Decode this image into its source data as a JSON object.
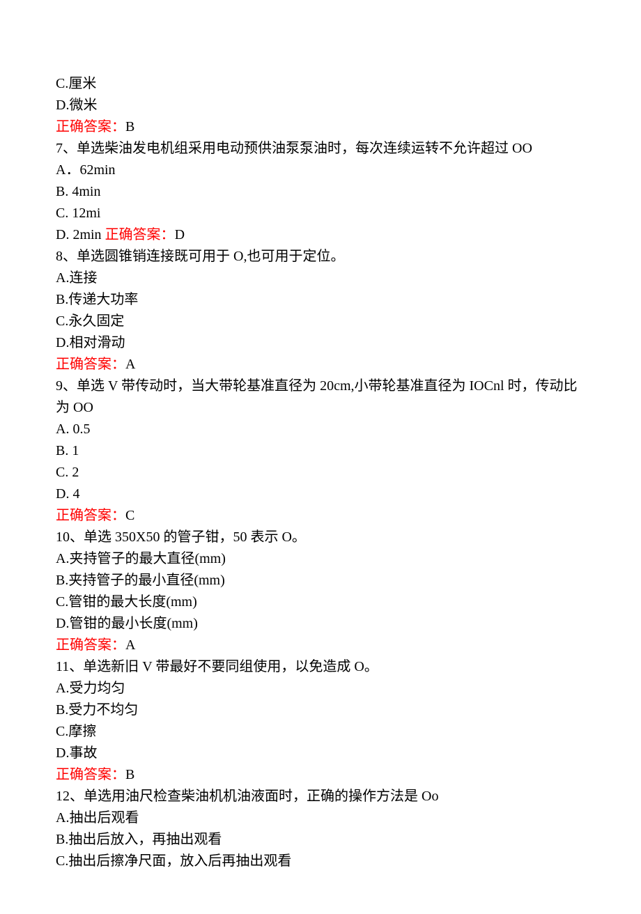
{
  "lines": [
    {
      "type": "plain",
      "text": "C.厘米"
    },
    {
      "type": "plain",
      "text": "D.微米"
    },
    {
      "type": "answer",
      "label": "正确答案：",
      "value": "B"
    },
    {
      "type": "plain",
      "text": "7、单选柴油发电机组采用电动预供油泵泵油时，每次连续运转不允许超过 OO"
    },
    {
      "type": "plain",
      "text": "A．62min"
    },
    {
      "type": "plain",
      "text": "B. 4min"
    },
    {
      "type": "plain",
      "text": "C. 12mi"
    },
    {
      "type": "inline_answer",
      "prefix": "D. 2min ",
      "label": "正确答案：",
      "value": "D"
    },
    {
      "type": "plain",
      "text": "8、单选圆锥销连接既可用于 O,也可用于定位。"
    },
    {
      "type": "plain",
      "text": "A.连接"
    },
    {
      "type": "plain",
      "text": "B.传递大功率"
    },
    {
      "type": "plain",
      "text": "C.永久固定"
    },
    {
      "type": "plain",
      "text": "D.相对滑动"
    },
    {
      "type": "answer",
      "label": "正确答案：",
      "value": "A"
    },
    {
      "type": "plain",
      "text": "9、单选 V 带传动时，当大带轮基准直径为 20cm,小带轮基准直径为 IOCnl 时，传动比为 OO"
    },
    {
      "type": "plain",
      "text": "A. 0.5"
    },
    {
      "type": "plain",
      "text": "B. 1"
    },
    {
      "type": "plain",
      "text": "C. 2"
    },
    {
      "type": "plain",
      "text": "D. 4"
    },
    {
      "type": "answer",
      "label": "正确答案：",
      "value": "C"
    },
    {
      "type": "plain",
      "text": "10、单选 350X50 的管子钳，50 表示 O。"
    },
    {
      "type": "plain",
      "text": "A.夹持管子的最大直径(mm)"
    },
    {
      "type": "plain",
      "text": "B.夹持管子的最小直径(mm)"
    },
    {
      "type": "plain",
      "text": "C.管钳的最大长度(mm)"
    },
    {
      "type": "plain",
      "text": "D.管钳的最小长度(mm)"
    },
    {
      "type": "answer",
      "label": "正确答案：",
      "value": "A"
    },
    {
      "type": "plain",
      "text": "11、单选新旧 V 带最好不要同组使用，以免造成 O。"
    },
    {
      "type": "plain",
      "text": "A.受力均匀"
    },
    {
      "type": "plain",
      "text": "B.受力不均匀"
    },
    {
      "type": "plain",
      "text": "C.摩擦"
    },
    {
      "type": "plain",
      "text": "D.事故"
    },
    {
      "type": "answer",
      "label": "正确答案：",
      "value": "B"
    },
    {
      "type": "plain",
      "text": "12、单选用油尺检查柴油机机油液面时，正确的操作方法是 Oo"
    },
    {
      "type": "plain",
      "text": "A.抽出后观看"
    },
    {
      "type": "plain",
      "text": "B.抽出后放入，再抽出观看"
    },
    {
      "type": "plain",
      "text": "C.抽出后擦净尺面，放入后再抽出观看"
    }
  ]
}
